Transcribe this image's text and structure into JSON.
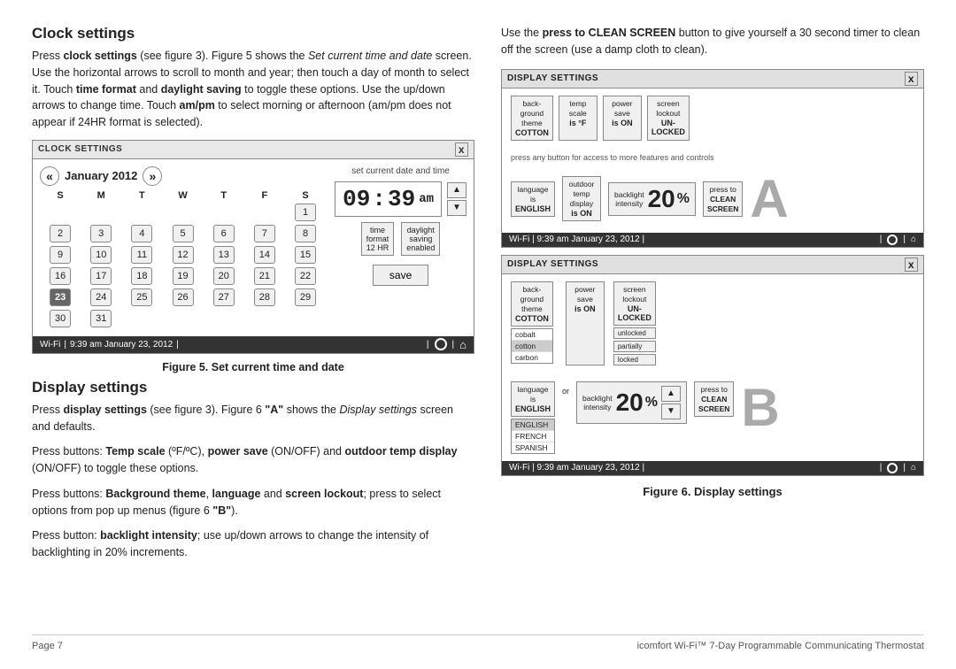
{
  "header": {
    "clock_settings_title": "Clock settings",
    "display_settings_title": "Display settings"
  },
  "clock_section": {
    "body1": "Press clock settings (see figure 3). Figure 5 shows the Set current time and date screen. Use the horizontal arrows to scroll to month and year; then touch a day of month to select it. Touch time format and daylight saving to toggle these options. Use the up/down arrows to change time. Touch am/pm to select morning or afternoon (am/pm does not appear if 24HR format is selected).",
    "figure_header": "CLOCK SETTINGS",
    "figure_x": "x",
    "month_year": "January 2012",
    "set_label": "set current date and time",
    "weekdays": [
      "S",
      "M",
      "T",
      "W",
      "T",
      "F",
      "S"
    ],
    "calendar_rows": [
      [
        null,
        null,
        null,
        null,
        null,
        null,
        "1"
      ],
      [
        "2",
        "3",
        "4",
        "5",
        "6",
        "7",
        "8"
      ],
      [
        "9",
        "10",
        "11",
        "12",
        "13",
        "14",
        "15"
      ],
      [
        "16",
        "17",
        "18",
        "19",
        "20",
        "21",
        "22"
      ],
      [
        "23",
        "24",
        "25",
        "26",
        "27",
        "28",
        "29"
      ],
      [
        "30",
        "31",
        null,
        null,
        null,
        null,
        null
      ]
    ],
    "selected_day": "23",
    "time_hour": "09",
    "time_minute": "39",
    "time_ampm": "am",
    "time_format_label": "time\nformat\n12 HR",
    "daylight_label": "daylight\nsaving\nenabled",
    "save_btn": "save",
    "wifi_text": "Wi-Fi",
    "wifi_time": "9:39 am January 23, 2012",
    "figure5_caption": "Figure 5. Set current time and date"
  },
  "display_section": {
    "body1": "Press display settings (see figure 3). Figure 6 \"A\" shows the Display settings screen and defaults.",
    "body2": "Press buttons: Temp scale (ºF/ºC), power save (ON/OFF) and outdoor temp display (ON/OFF) to toggle these options.",
    "body3": "Press buttons: Background theme, language and screen lockout; press to select options from pop up menus (figure 6 \"B\").",
    "body4": "Press button: backlight intensity; use up/down arrows to change the intensity of backlighting in 20% increments."
  },
  "right_section": {
    "intro": "Use the press to CLEAN SCREEN button to give yourself a 30 second timer to clean off the screen (use a damp cloth to clean).",
    "figure_a": {
      "header": "DISPLAY SETTINGS",
      "x": "x",
      "btn_background": {
        "label1": "back-",
        "label2": "ground",
        "label3": "theme",
        "val": "COTTON"
      },
      "btn_temp_scale": {
        "label1": "temp",
        "label2": "scale",
        "val": "is °F"
      },
      "btn_power_save": {
        "label1": "power",
        "label2": "save",
        "val": "is ON"
      },
      "btn_screen_lockout": {
        "label1": "screen",
        "label2": "lockout",
        "val": "UN-\nLOCKED"
      },
      "press_info": "press any button for access to more features and controls",
      "btn_language": {
        "label1": "language",
        "label2": "is",
        "val": "ENGLISH"
      },
      "btn_outdoor": {
        "label1": "outdoor",
        "label2": "temp",
        "label3": "display",
        "val": "is ON"
      },
      "btn_backlight": {
        "label1": "backlight",
        "label2": "intensity"
      },
      "backlight_val": "20",
      "backlight_pct": "%",
      "btn_clean": {
        "label1": "press to",
        "label2": "CLEAN",
        "label3": "SCREEN"
      },
      "letter": "A",
      "wifi_text": "Wi-Fi",
      "wifi_time": "9:39 am January 23, 2012"
    },
    "figure_b": {
      "header": "DISPLAY SETTINGS",
      "x": "x",
      "btn_background": {
        "label1": "back-",
        "label2": "ground",
        "label3": "theme",
        "val": "COTTON"
      },
      "theme_options": [
        "cobalt",
        "cotton",
        "carbon"
      ],
      "btn_power_save": {
        "label1": "power",
        "label2": "save",
        "val": "is ON"
      },
      "btn_screen_lockout": {
        "label1": "screen",
        "label2": "lockout",
        "val": "UN-\nLOCKED"
      },
      "lockout_opts": [
        "unlocked",
        "partially",
        "locked"
      ],
      "btn_language": {
        "label1": "language",
        "label2": "is",
        "val": "ENGLISH"
      },
      "lang_options": [
        "ENGLISH",
        "FRENCH",
        "SPANISH"
      ],
      "btn_outdoor_label": "or",
      "btn_backlight": {
        "label1": "backlight",
        "label2": "intensity"
      },
      "backlight_val": "20",
      "backlight_pct": "%",
      "btn_clean": {
        "label1": "press to",
        "label2": "CLEAN",
        "label3": "SCREEN"
      },
      "letter": "B",
      "wifi_text": "Wi-Fi",
      "wifi_time": "9:39 am January 23, 2012"
    },
    "figure6_caption": "Figure 6. Display settings"
  },
  "footer": {
    "page_label": "Page 7",
    "product_name": "icomfort Wi-Fi™ 7-Day Programmable Communicating Thermostat"
  }
}
